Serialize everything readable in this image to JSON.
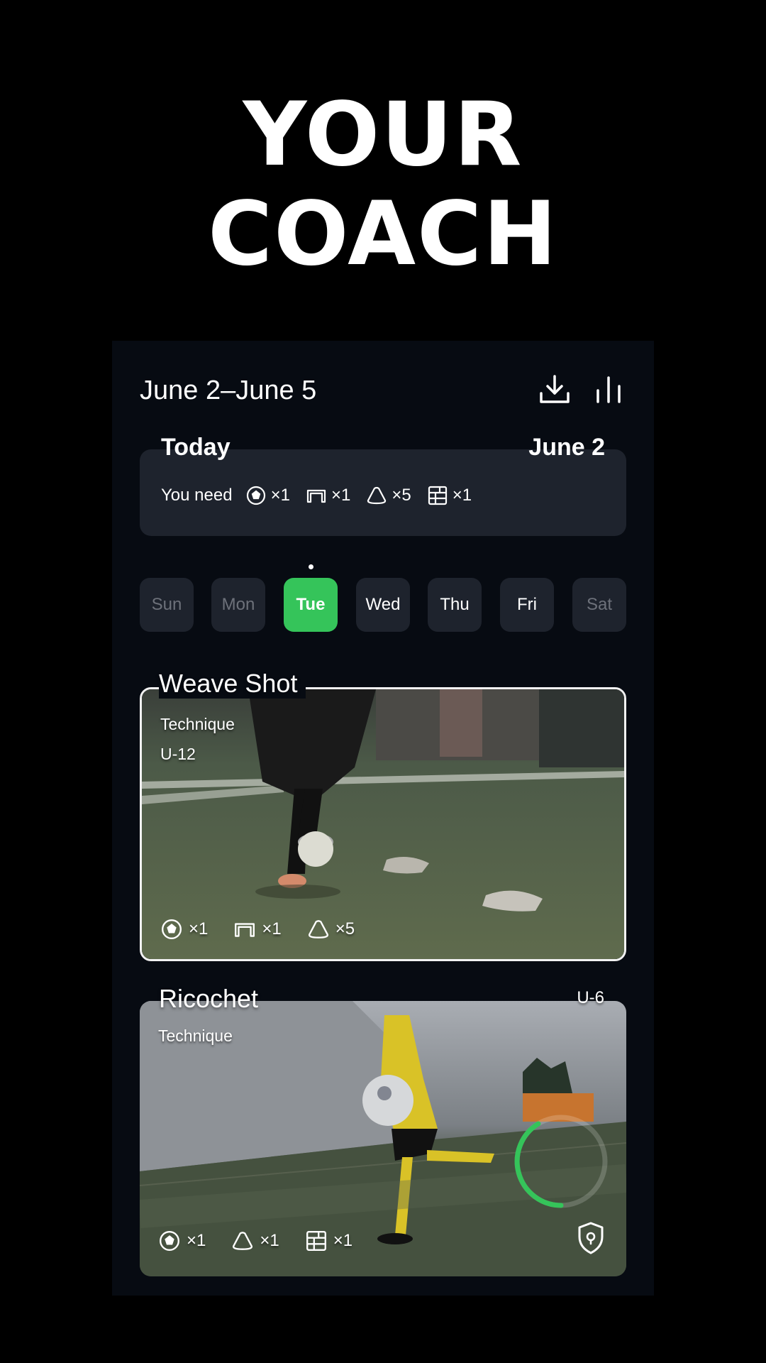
{
  "hero": {
    "line1": "YOUR",
    "line2": "COACH"
  },
  "header": {
    "date_range": "June 2–June 5",
    "download_icon": "download-icon",
    "stats_icon": "bar-chart-icon"
  },
  "today": {
    "title": "Today",
    "date": "June 2",
    "need_label": "You need",
    "equipment": [
      {
        "icon": "ball-icon",
        "count": "×1"
      },
      {
        "icon": "goal-icon",
        "count": "×1"
      },
      {
        "icon": "cone-icon",
        "count": "×5"
      },
      {
        "icon": "rebounder-icon",
        "count": "×1"
      }
    ]
  },
  "days": [
    "Sun",
    "Mon",
    "Tue",
    "Wed",
    "Thu",
    "Fri",
    "Sat"
  ],
  "selected_day": "Tue",
  "drills": [
    {
      "title": "Weave Shot",
      "category": "Technique",
      "age": "U-12",
      "equipment": [
        {
          "icon": "ball-icon",
          "count": "×1"
        },
        {
          "icon": "goal-icon",
          "count": "×1"
        },
        {
          "icon": "cone-icon",
          "count": "×5"
        }
      ]
    },
    {
      "title": "Ricochet",
      "category": "Technique",
      "age": "U-6",
      "equipment": [
        {
          "icon": "ball-icon",
          "count": "×1"
        },
        {
          "icon": "cone-icon",
          "count": "×1"
        },
        {
          "icon": "rebounder-icon",
          "count": "×1"
        }
      ],
      "badge_icon": "shield-lock-icon"
    }
  ],
  "colors": {
    "accent": "#35c45a",
    "card_bg": "#1e232d",
    "panel_bg": "#070b12"
  }
}
